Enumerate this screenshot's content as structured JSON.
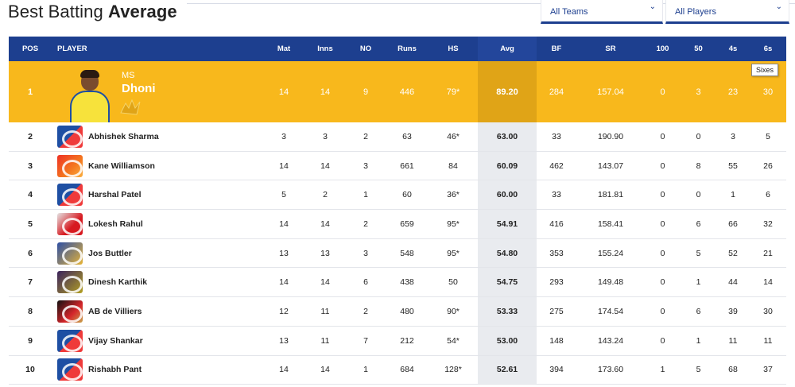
{
  "header": {
    "title_light": "Best Batting ",
    "title_bold": "Average"
  },
  "filters": {
    "teams_label": "All Teams",
    "players_label": "All Players"
  },
  "columns": [
    "POS",
    "PLAYER",
    "Mat",
    "Inns",
    "NO",
    "Runs",
    "HS",
    "Avg",
    "BF",
    "SR",
    "100",
    "50",
    "4s",
    "6s"
  ],
  "tooltip": "Sixes",
  "featured": {
    "first_name": "MS",
    "last_name": "Dhoni",
    "team_color": "#f8b81c"
  },
  "rows": [
    {
      "pos": "1",
      "player": "MS Dhoni",
      "logo": "csk-logo-icon",
      "mat": "14",
      "inns": "14",
      "no": "9",
      "runs": "446",
      "hs": "79*",
      "avg": "89.20",
      "bf": "284",
      "sr": "157.04",
      "h100": "0",
      "h50": "3",
      "fours": "23",
      "sixes": "30"
    },
    {
      "pos": "2",
      "player": "Abhishek Sharma",
      "logo": "dc-logo-icon",
      "mat": "3",
      "inns": "3",
      "no": "2",
      "runs": "63",
      "hs": "46*",
      "avg": "63.00",
      "bf": "33",
      "sr": "190.90",
      "h100": "0",
      "h50": "0",
      "fours": "3",
      "sixes": "5"
    },
    {
      "pos": "3",
      "player": "Kane Williamson",
      "logo": "srh-logo-icon",
      "mat": "14",
      "inns": "14",
      "no": "3",
      "runs": "661",
      "hs": "84",
      "avg": "60.09",
      "bf": "462",
      "sr": "143.07",
      "h100": "0",
      "h50": "8",
      "fours": "55",
      "sixes": "26"
    },
    {
      "pos": "4",
      "player": "Harshal Patel",
      "logo": "dc-logo-icon",
      "mat": "5",
      "inns": "2",
      "no": "1",
      "runs": "60",
      "hs": "36*",
      "avg": "60.00",
      "bf": "33",
      "sr": "181.81",
      "h100": "0",
      "h50": "0",
      "fours": "1",
      "sixes": "6"
    },
    {
      "pos": "5",
      "player": "Lokesh Rahul",
      "logo": "kxip-logo-icon",
      "mat": "14",
      "inns": "14",
      "no": "2",
      "runs": "659",
      "hs": "95*",
      "avg": "54.91",
      "bf": "416",
      "sr": "158.41",
      "h100": "0",
      "h50": "6",
      "fours": "66",
      "sixes": "32"
    },
    {
      "pos": "6",
      "player": "Jos Buttler",
      "logo": "rr-logo-icon",
      "mat": "13",
      "inns": "13",
      "no": "3",
      "runs": "548",
      "hs": "95*",
      "avg": "54.80",
      "bf": "353",
      "sr": "155.24",
      "h100": "0",
      "h50": "5",
      "fours": "52",
      "sixes": "21"
    },
    {
      "pos": "7",
      "player": "Dinesh Karthik",
      "logo": "kkr-logo-icon",
      "mat": "14",
      "inns": "14",
      "no": "6",
      "runs": "438",
      "hs": "50",
      "avg": "54.75",
      "bf": "293",
      "sr": "149.48",
      "h100": "0",
      "h50": "1",
      "fours": "44",
      "sixes": "14"
    },
    {
      "pos": "8",
      "player": "AB de Villiers",
      "logo": "rcb-logo-icon",
      "mat": "12",
      "inns": "11",
      "no": "2",
      "runs": "480",
      "hs": "90*",
      "avg": "53.33",
      "bf": "275",
      "sr": "174.54",
      "h100": "0",
      "h50": "6",
      "fours": "39",
      "sixes": "30"
    },
    {
      "pos": "9",
      "player": "Vijay Shankar",
      "logo": "dc-logo-icon",
      "mat": "13",
      "inns": "11",
      "no": "7",
      "runs": "212",
      "hs": "54*",
      "avg": "53.00",
      "bf": "148",
      "sr": "143.24",
      "h100": "0",
      "h50": "1",
      "fours": "11",
      "sixes": "11"
    },
    {
      "pos": "10",
      "player": "Rishabh Pant",
      "logo": "dc-logo-icon",
      "mat": "14",
      "inns": "14",
      "no": "1",
      "runs": "684",
      "hs": "128*",
      "avg": "52.61",
      "bf": "394",
      "sr": "173.60",
      "h100": "1",
      "h50": "5",
      "fours": "68",
      "sixes": "37"
    }
  ],
  "colors": {
    "header_bg": "#1d3f8f",
    "highlight_row": "#f8b81c",
    "avg_column": "#e9ebef"
  }
}
